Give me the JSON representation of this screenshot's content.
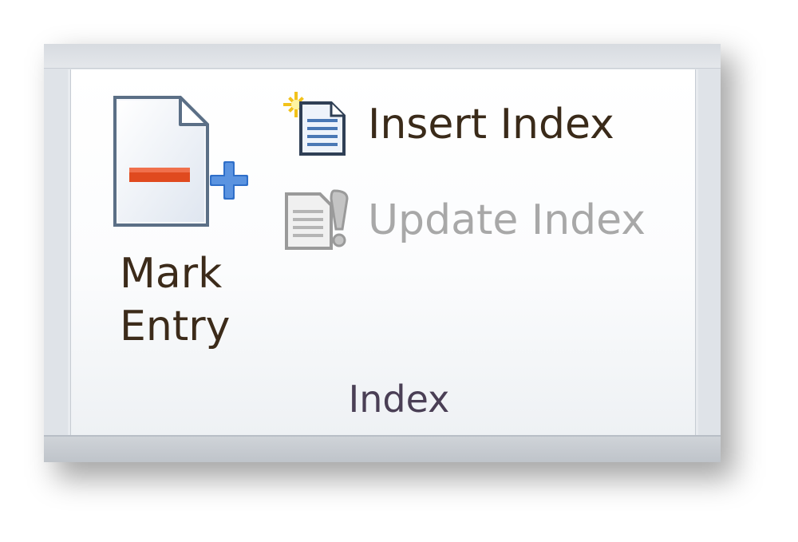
{
  "ribbon_group": {
    "caption": "Index",
    "buttons": {
      "mark_entry": {
        "label_line1": "Mark",
        "label_line2": "Entry",
        "icon": "mark-entry-icon",
        "enabled": true
      },
      "insert_index": {
        "label": "Insert Index",
        "icon": "insert-index-icon",
        "enabled": true
      },
      "update_index": {
        "label": "Update Index",
        "icon": "update-index-icon",
        "enabled": false
      }
    }
  },
  "colors": {
    "label_text": "#3a2a19",
    "disabled_text": "#a8a8a8",
    "caption_text": "#4a3f55",
    "accent_red": "#e04a1f",
    "accent_blue": "#2f6fc9"
  }
}
